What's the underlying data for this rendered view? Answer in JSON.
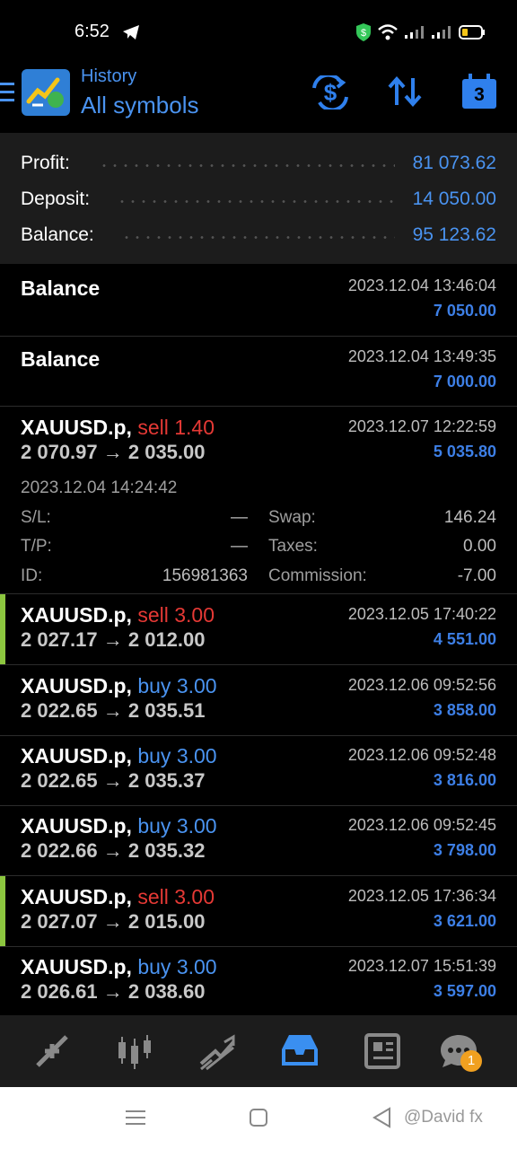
{
  "status_bar": {
    "time": "6:52"
  },
  "header": {
    "title": "History",
    "subtitle": "All symbols",
    "calendar_day": "3"
  },
  "summary": [
    {
      "label": "Profit:",
      "value": "81 073.62"
    },
    {
      "label": "Deposit:",
      "value": "14 050.00"
    },
    {
      "label": "Balance:",
      "value": "95 123.62"
    }
  ],
  "balance_ops": [
    {
      "title": "Balance",
      "time": "2023.12.04 13:46:04",
      "amount": "7 050.00"
    },
    {
      "title": "Balance",
      "time": "2023.12.04 13:49:35",
      "amount": "7 000.00"
    }
  ],
  "expanded_deal": {
    "symbol": "XAUUSD.p,",
    "side": "sell",
    "volume": "1.40",
    "prices": "2 070.97 → 2 035.00",
    "time": "2023.12.07 12:22:59",
    "profit": "5 035.80",
    "open_time": "2023.12.04 14:24:42",
    "sl_label": "S/L:",
    "sl_value": "—",
    "tp_label": "T/P:",
    "tp_value": "—",
    "id_label": "ID:",
    "id_value": "156981363",
    "swap_label": "Swap:",
    "swap_value": "146.24",
    "taxes_label": "Taxes:",
    "taxes_value": "0.00",
    "commission_label": "Commission:",
    "commission_value": "-7.00"
  },
  "deals": [
    {
      "symbol": "XAUUSD.p,",
      "side": "sell",
      "volume": "3.00",
      "prices": "2 027.17 → 2 012.00",
      "time": "2023.12.05 17:40:22",
      "profit": "4 551.00",
      "marked": true
    },
    {
      "symbol": "XAUUSD.p,",
      "side": "buy",
      "volume": "3.00",
      "prices": "2 022.65 → 2 035.51",
      "time": "2023.12.06 09:52:56",
      "profit": "3 858.00",
      "marked": false
    },
    {
      "symbol": "XAUUSD.p,",
      "side": "buy",
      "volume": "3.00",
      "prices": "2 022.65 → 2 035.37",
      "time": "2023.12.06 09:52:48",
      "profit": "3 816.00",
      "marked": false
    },
    {
      "symbol": "XAUUSD.p,",
      "side": "buy",
      "volume": "3.00",
      "prices": "2 022.66 → 2 035.32",
      "time": "2023.12.06 09:52:45",
      "profit": "3 798.00",
      "marked": false
    },
    {
      "symbol": "XAUUSD.p,",
      "side": "sell",
      "volume": "3.00",
      "prices": "2 027.07 → 2 015.00",
      "time": "2023.12.05 17:36:34",
      "profit": "3 621.00",
      "marked": true
    },
    {
      "symbol": "XAUUSD.p,",
      "side": "buy",
      "volume": "3.00",
      "prices": "2 026.61 → 2 038.60",
      "time": "2023.12.07 15:51:39",
      "profit": "3 597.00",
      "marked": false
    }
  ],
  "bottom_nav": {
    "chat_badge": "1"
  },
  "watermark": "@David fx",
  "colors": {
    "accent": "#4a93f0",
    "sell": "#e53935",
    "buy": "#4a93f0",
    "marker": "#8cc63f",
    "profit": "#3d7fe6"
  }
}
